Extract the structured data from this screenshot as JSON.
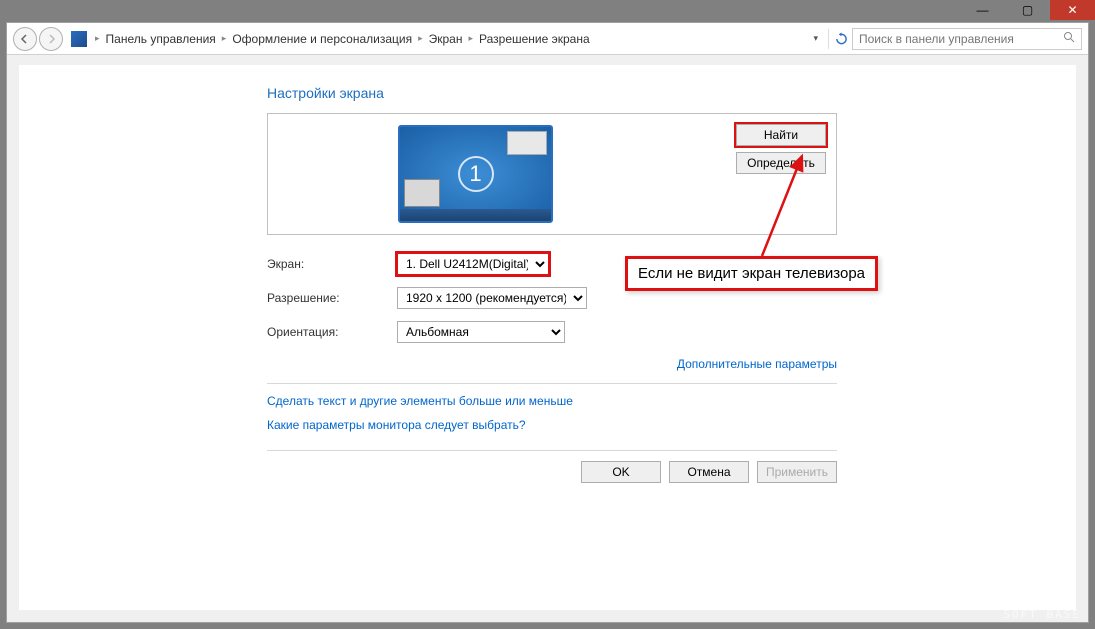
{
  "titlebar": {
    "min": "—",
    "max": "▢",
    "close": "✕"
  },
  "breadcrumb": {
    "items": [
      "Панель управления",
      "Оформление и персонализация",
      "Экран",
      "Разрешение экрана"
    ]
  },
  "search": {
    "placeholder": "Поиск в панели управления"
  },
  "page": {
    "title": "Настройки экрана"
  },
  "monitor": {
    "number": "1"
  },
  "buttons": {
    "find": "Найти",
    "detect": "Определить",
    "ok": "OK",
    "cancel": "Отмена",
    "apply": "Применить"
  },
  "labels": {
    "screen": "Экран:",
    "resolution": "Разрешение:",
    "orientation": "Ориентация:"
  },
  "values": {
    "screen": "1. Dell U2412M(Digital)",
    "resolution": "1920 x 1200 (рекомендуется)",
    "orientation": "Альбомная"
  },
  "links": {
    "advanced": "Дополнительные параметры",
    "text_size": "Сделать текст и другие элементы больше или меньше",
    "which_settings": "Какие параметры монитора следует выбрать?"
  },
  "callout": {
    "text": "Если не видит экран телевизора"
  },
  "watermark": "SOFT BASE"
}
